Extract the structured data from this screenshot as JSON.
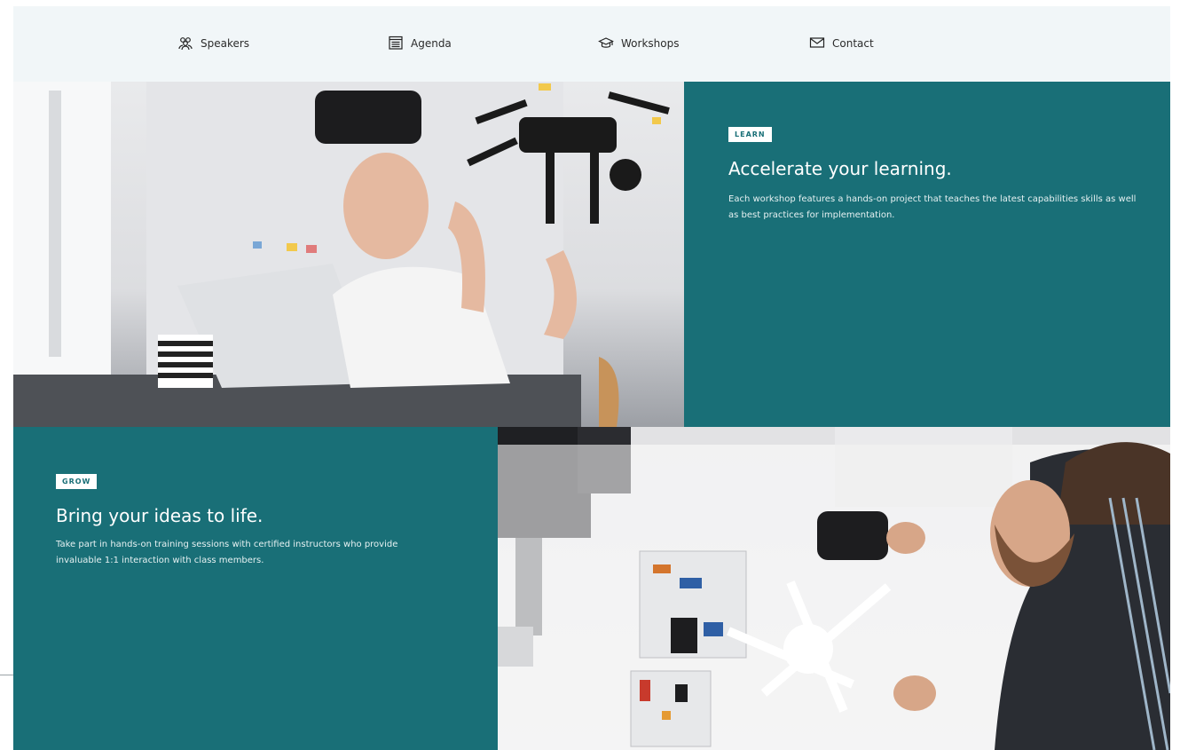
{
  "nav": {
    "items": [
      {
        "label": "Speakers",
        "icon": "people-icon"
      },
      {
        "label": "Agenda",
        "icon": "calendar-icon"
      },
      {
        "label": "Workshops",
        "icon": "graduation-cap-icon"
      },
      {
        "label": "Contact",
        "icon": "mail-icon"
      }
    ]
  },
  "sections": [
    {
      "tag": "LEARN",
      "headline": "Accelerate your learning.",
      "body": "Each workshop features a hands-on project that teaches the latest capabilities skills as well as best practices for implementation."
    },
    {
      "tag": "GROW",
      "headline": "Bring your ideas to life.",
      "body": "Take part in hands-on training sessions with certified instructors who provide invaluable 1:1 interaction with class members."
    }
  ],
  "colors": {
    "panel": "#196f77",
    "nav_background": "#f1f6f8"
  }
}
